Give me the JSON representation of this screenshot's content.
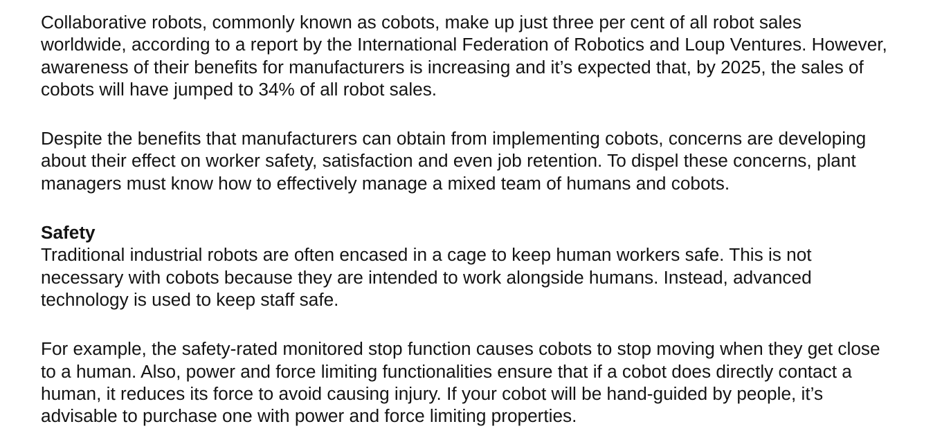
{
  "article": {
    "paragraph_1": "Collaborative robots, commonly known as cobots, make up just three per cent of all robot sales\nworldwide, according to a report by the International Federation of Robotics and Loup Ventures. However,\nawareness of their benefits for manufacturers is increasing and it’s expected that, by 2025, the sales of\ncobots will have jumped to 34% of all robot sales.",
    "paragraph_2": "Despite the benefits that manufacturers can obtain from implementing cobots, concerns are developing\nabout their effect on worker safety, satisfaction and even job retention. To dispel these concerns, plant\nmanagers must know how to effectively manage a mixed team of humans and cobots.",
    "section_heading": "Safety",
    "paragraph_3": "Traditional industrial robots are often encased in a cage to keep human workers safe. This is not\nnecessary with cobots because they are intended to work alongside humans. Instead, advanced\ntechnology is used to keep staff safe.",
    "paragraph_4": "For example, the safety-rated monitored stop function causes cobots to stop moving when they get close\nto a human. Also, power and force limiting functionalities ensure that if a cobot does directly contact a\nhuman, it reduces its force to avoid causing injury. If your cobot will be hand-guided by people, it’s\nadvisable to purchase one with power and force limiting properties."
  }
}
